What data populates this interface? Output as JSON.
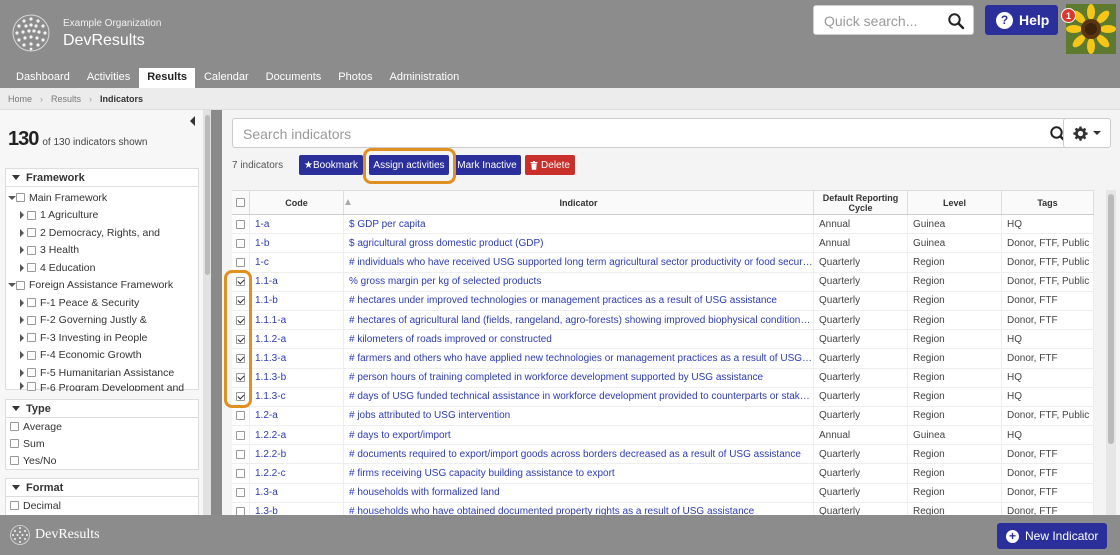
{
  "header": {
    "org_name": "Example Organization",
    "app_name": "DevResults",
    "search_placeholder": "Quick search...",
    "help_label": "Help",
    "notification_count": "1"
  },
  "nav": {
    "tabs": [
      {
        "label": "Dashboard",
        "active": false
      },
      {
        "label": "Activities",
        "active": false
      },
      {
        "label": "Results",
        "active": true
      },
      {
        "label": "Calendar",
        "active": false
      },
      {
        "label": "Documents",
        "active": false
      },
      {
        "label": "Photos",
        "active": false
      },
      {
        "label": "Administration",
        "active": false
      }
    ]
  },
  "breadcrumb": {
    "items": [
      "Home",
      "Results",
      "Indicators"
    ]
  },
  "sidebar": {
    "count_shown": "130",
    "count_text": "of 130 indicators shown",
    "framework": {
      "title": "Framework",
      "tree": [
        {
          "label": "Main Framework",
          "level": 0,
          "expanded": true
        },
        {
          "label": "1 Agriculture",
          "level": 1,
          "expanded": false
        },
        {
          "label": "2 Democracy, Rights, and",
          "level": 1,
          "expanded": false
        },
        {
          "label": "3 Health",
          "level": 1,
          "expanded": false
        },
        {
          "label": "4 Education",
          "level": 1,
          "expanded": false
        },
        {
          "label": "Foreign Assistance Framework",
          "level": 0,
          "expanded": true
        },
        {
          "label": "F-1 Peace & Security",
          "level": 1,
          "expanded": false
        },
        {
          "label": "F-2 Governing Justly &",
          "level": 1,
          "expanded": false
        },
        {
          "label": "F-3 Investing in People",
          "level": 1,
          "expanded": false
        },
        {
          "label": "F-4 Economic Growth",
          "level": 1,
          "expanded": false
        },
        {
          "label": "F-5 Humanitarian Assistance",
          "level": 1,
          "expanded": false
        },
        {
          "label": "F-6 Program Development and",
          "level": 1,
          "expanded": false
        }
      ]
    },
    "type": {
      "title": "Type",
      "options": [
        "Average",
        "Sum",
        "Yes/No"
      ]
    },
    "format": {
      "title": "Format",
      "options": [
        "Decimal"
      ]
    }
  },
  "main": {
    "search_placeholder": "Search indicators",
    "selected_count": "7 indicators",
    "actions": {
      "bookmark": "★Bookmark",
      "assign": "Assign activities",
      "inactive": "Mark Inactive",
      "delete": "Delete"
    },
    "columns": {
      "code": "Code",
      "indicator": "Indicator",
      "cycle": "Default Reporting Cycle",
      "level": "Level",
      "tags": "Tags"
    },
    "rows": [
      {
        "checked": false,
        "code": "1-a",
        "indicator": "$ GDP per capita",
        "cycle": "Annual",
        "level": "Guinea",
        "tags": "HQ"
      },
      {
        "checked": false,
        "code": "1-b",
        "indicator": "$ agricultural gross domestic product (GDP)",
        "cycle": "Annual",
        "level": "Guinea",
        "tags": "Donor, FTF, Public"
      },
      {
        "checked": false,
        "code": "1-c",
        "indicator": "# individuals who have received USG supported long term agricultural sector productivity or food security trai...",
        "cycle": "Quarterly",
        "level": "Region",
        "tags": "Donor, FTF, Public"
      },
      {
        "checked": true,
        "code": "1.1-a",
        "indicator": "% gross margin per kg of selected products",
        "cycle": "Quarterly",
        "level": "Region",
        "tags": "Donor, FTF, Public"
      },
      {
        "checked": true,
        "code": "1.1-b",
        "indicator": "# hectares under improved technologies or management practices as a result of USG assistance",
        "cycle": "Quarterly",
        "level": "Region",
        "tags": "Donor, FTF"
      },
      {
        "checked": true,
        "code": "1.1.1-a",
        "indicator": "# hectares of agricultural land (fields, rangeland, agro-forests) showing improved biophysical conditions as a r...",
        "cycle": "Quarterly",
        "level": "Region",
        "tags": "Donor, FTF"
      },
      {
        "checked": true,
        "code": "1.1.2-a",
        "indicator": "# kilometers of roads improved or constructed",
        "cycle": "Quarterly",
        "level": "Region",
        "tags": "HQ"
      },
      {
        "checked": true,
        "code": "1.1.3-a",
        "indicator": "# farmers and others who have applied new technologies or management practices as a result of USG assista...",
        "cycle": "Quarterly",
        "level": "Region",
        "tags": "Donor, FTF"
      },
      {
        "checked": true,
        "code": "1.1.3-b",
        "indicator": "# person hours of training completed in workforce development supported by USG assistance",
        "cycle": "Quarterly",
        "level": "Region",
        "tags": "HQ"
      },
      {
        "checked": true,
        "code": "1.1.3-c",
        "indicator": "# days of USG funded technical assistance in workforce development provided to counterparts or stakeholders",
        "cycle": "Quarterly",
        "level": "Region",
        "tags": "HQ"
      },
      {
        "checked": false,
        "code": "1.2-a",
        "indicator": "# jobs attributed to USG intervention",
        "cycle": "Quarterly",
        "level": "Region",
        "tags": "Donor, FTF, Public"
      },
      {
        "checked": false,
        "code": "1.2.2-a",
        "indicator": "# days to export/import",
        "cycle": "Annual",
        "level": "Guinea",
        "tags": "HQ"
      },
      {
        "checked": false,
        "code": "1.2.2-b",
        "indicator": "# documents required to export/import goods across borders decreased as a result of USG assistance",
        "cycle": "Quarterly",
        "level": "Region",
        "tags": "Donor, FTF"
      },
      {
        "checked": false,
        "code": "1.2.2-c",
        "indicator": "# firms receiving USG capacity building assistance to export",
        "cycle": "Quarterly",
        "level": "Region",
        "tags": "Donor, FTF"
      },
      {
        "checked": false,
        "code": "1.3-a",
        "indicator": "# households with formalized land",
        "cycle": "Quarterly",
        "level": "Region",
        "tags": "Donor, FTF"
      },
      {
        "checked": false,
        "code": "1.3-b",
        "indicator": "# households who have obtained documented property rights as a result of USG assistance",
        "cycle": "Quarterly",
        "level": "Region",
        "tags": "Donor, FTF"
      }
    ]
  },
  "footer": {
    "app_name": "DevResults",
    "new_indicator_label": "New Indicator"
  },
  "colors": {
    "brand_blue": "#2b2f9c",
    "danger_red": "#c9302c",
    "highlight_orange": "#e09020",
    "link_blue": "#2b3bb8"
  }
}
